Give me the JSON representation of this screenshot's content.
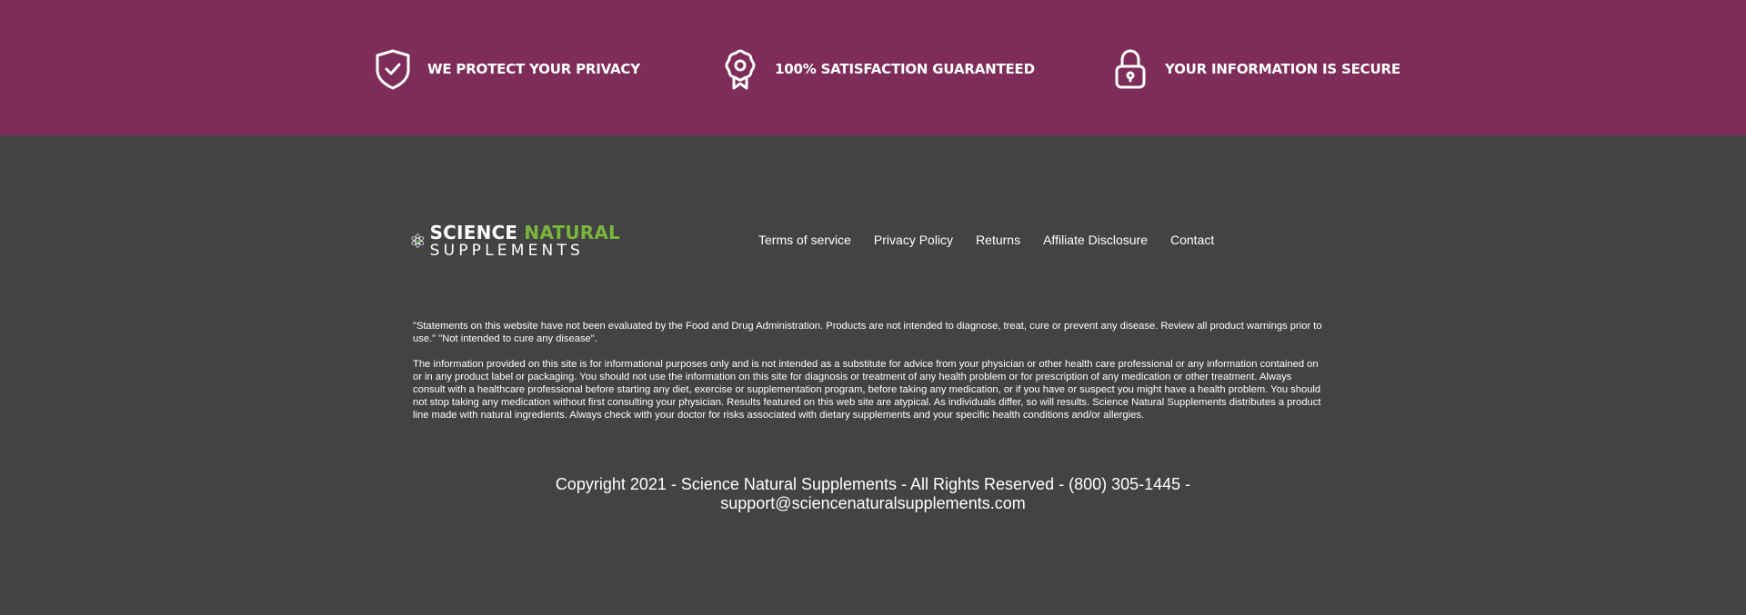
{
  "trust_bar": {
    "privacy": {
      "label": "WE PROTECT YOUR PRIVACY",
      "icon": "shield-check-icon"
    },
    "satisfaction": {
      "label": "100% SATISFACTION GUARANTEED",
      "icon": "award-ribbon-icon"
    },
    "secure": {
      "label": "YOUR INFORMATION IS SECURE",
      "icon": "padlock-icon"
    }
  },
  "logo": {
    "word1": "SCIENCE",
    "word2": "NATURAL",
    "word3": "SUPPLEMENTS",
    "accent_color": "#7cb53d"
  },
  "footer_nav": [
    "Terms of service",
    "Privacy Policy",
    "Returns",
    "Affiliate Disclosure",
    "Contact"
  ],
  "disclaimer": {
    "p1": "\"Statements on this website have not been evaluated by the Food and Drug Administration. Products are not intended to diagnose, treat, cure or prevent any disease. Review all product warnings prior to use.\" \"Not intended to cure any disease\".",
    "p2": "The information provided on this site is for informational purposes only and is not intended as a substitute for advice from your physician or other health care professional or any information contained on or in any product label or packaging. You should not use the information on this site for diagnosis or treatment of any health problem or for prescription of any medication or other treatment. Always consult with a healthcare professional before starting any diet, exercise or supplementation program, before taking any medication, or if you have or suspect you might have a health problem. You should not stop taking any medication without first consulting your physician. Results featured on this web site are atypical. As individuals differ, so will results. Science Natural Supplements distributes a product line made with natural ingredients. Always check with your doctor for risks associated with dietary supplements and your specific health conditions and/or allergies."
  },
  "copyright": {
    "line1": "Copyright 2021 - Science Natural Supplements - All Rights Reserved - (800) 305-1445 -",
    "line2": "support@sciencenaturalsupplements.com"
  },
  "colors": {
    "trust_bar_bg": "#7d2d57",
    "footer_bg": "#434343",
    "text": "#ffffff"
  }
}
